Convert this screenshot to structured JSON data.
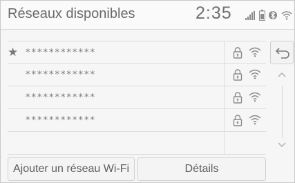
{
  "header": {
    "title": "Réseaux disponibles",
    "clock": "2:35"
  },
  "networks": [
    {
      "ssid": "************",
      "favorite": true,
      "secured": true
    },
    {
      "ssid": "************",
      "favorite": false,
      "secured": true
    },
    {
      "ssid": "************",
      "favorite": false,
      "secured": true
    },
    {
      "ssid": "************",
      "favorite": false,
      "secured": true
    }
  ],
  "footer": {
    "add_label": "Ajouter un réseau Wi-Fi",
    "details_label": "Détails"
  },
  "icons": {
    "star": "star-icon",
    "lock": "lock-icon",
    "wifi": "wifi-icon",
    "back": "back-arrow-icon",
    "scroll_up": "chevron-up-icon",
    "scroll_down": "chevron-down-icon",
    "signal": "cellular-signal-icon",
    "battery": "battery-icon",
    "bluetooth": "bluetooth-icon"
  },
  "colors": {
    "background": "#f6f6f6",
    "text": "#6a6a6a",
    "icon": "#8a8a8a"
  }
}
